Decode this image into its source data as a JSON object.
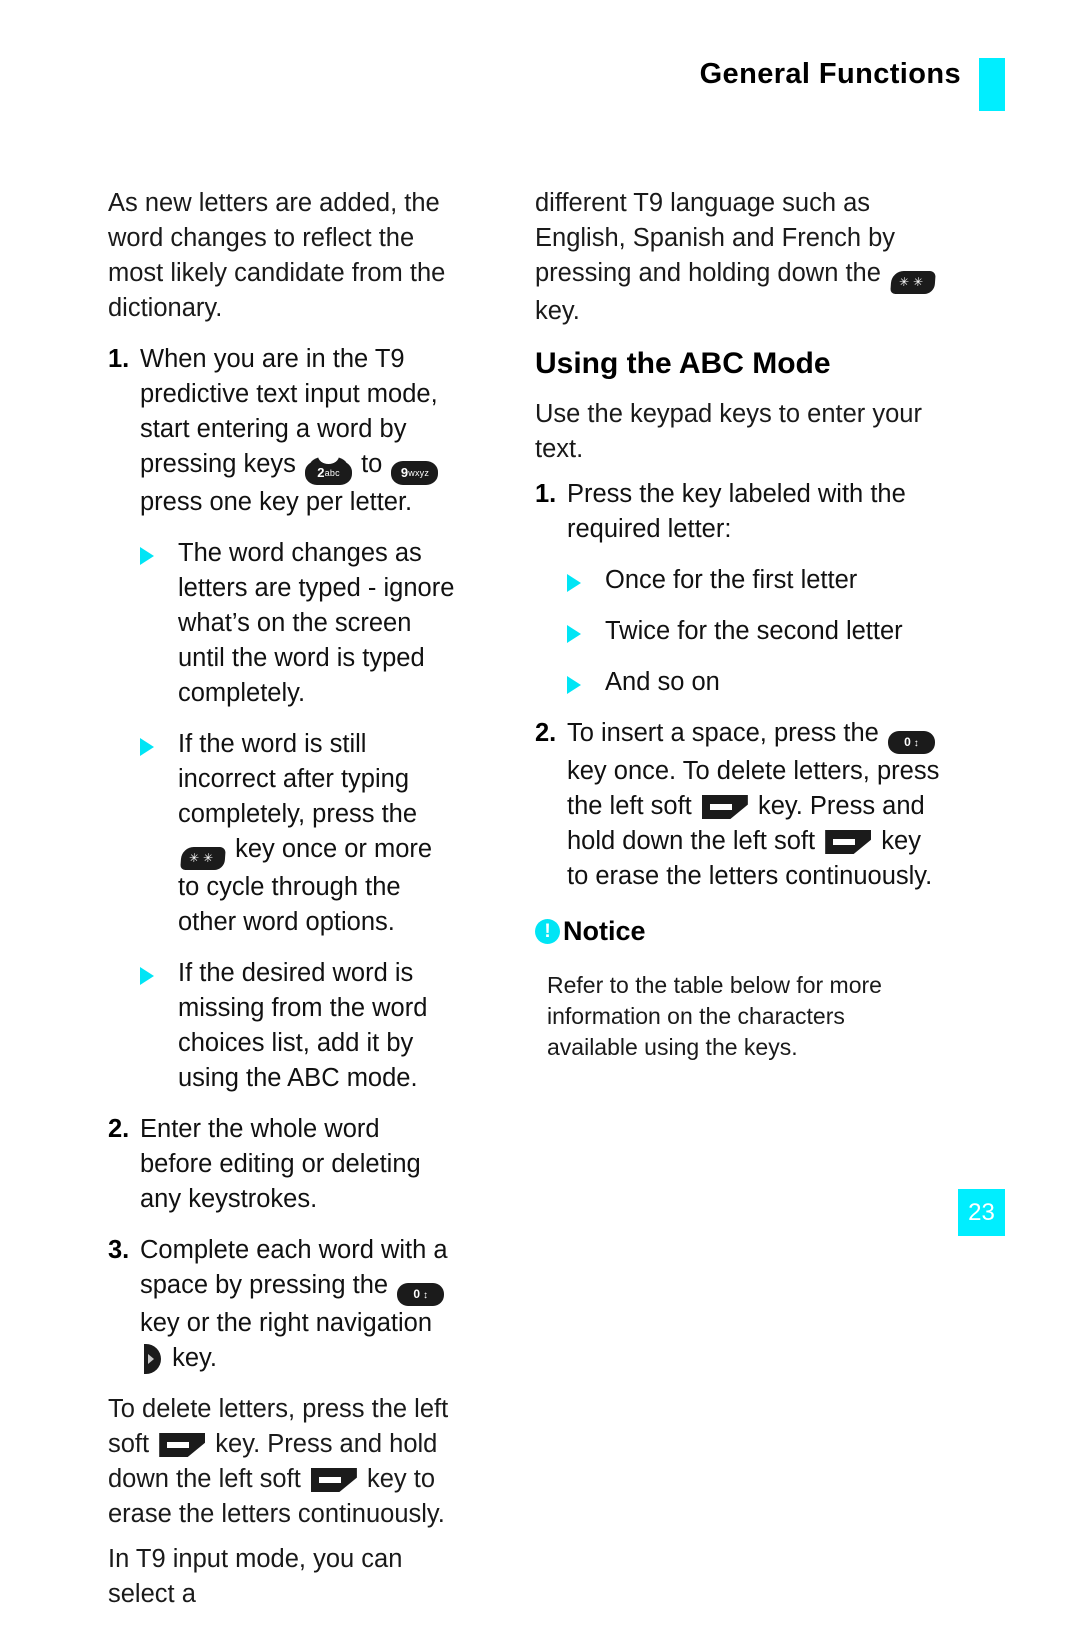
{
  "header": {
    "title": "General Functions",
    "accent_color": "#00eeff"
  },
  "page_number": "23",
  "colors": {
    "accent": "#00eeff",
    "bullet": "#00e5f5",
    "text": "#1a1a1a"
  },
  "left_column": {
    "intro": "As new letters are added, the word changes to reflect the most likely candidate from the dictionary.",
    "step1": {
      "num": "1.",
      "text_a": "When you are in the T9 predictive text input mode, start entering a word by pressing keys",
      "text_b": "to",
      "text_c": "press one key per letter.",
      "key_from": {
        "icon": "key-2-abc",
        "digit": "2",
        "letters": "abc"
      },
      "key_to": {
        "icon": "key-9-wxyz",
        "digit": "9",
        "letters": "wxyz"
      }
    },
    "bullets": [
      {
        "text": "The word changes as letters are typed - ignore what’s on the screen until the word is typed completely."
      },
      {
        "text_a": "If the word is still incorrect after typing completely, press the",
        "key": {
          "icon": "key-star",
          "label": "✱✱"
        },
        "text_b": "key once or more to cycle through the other word options."
      },
      {
        "text": "If the desired word is missing from the word choices list, add it by using the ABC mode."
      }
    ],
    "step2": {
      "num": "2.",
      "text": "Enter the whole word before editing or deleting any keystrokes."
    },
    "step3": {
      "num": "3.",
      "text_a": "Complete each word with a space by pressing the",
      "key_zero": {
        "icon": "key-0",
        "digit": "0",
        "symbol": "↕"
      },
      "text_b": "key or the right navigation",
      "key_nav": {
        "icon": "key-nav-right"
      },
      "text_c": "key."
    },
    "delete_para": {
      "text_a": "To delete letters, press the left soft",
      "key_soft_1": {
        "icon": "key-soft-left"
      },
      "text_b": "key. Press and hold down the left soft",
      "key_soft_2": {
        "icon": "key-soft-left"
      },
      "text_c": "key to erase the letters continuously."
    },
    "tail": "In T9 input mode, you can select a"
  },
  "right_column": {
    "continuation": {
      "text_a": "different T9 language such as English, Spanish and French by pressing and holding down the",
      "key": {
        "icon": "key-star",
        "label": "✱✱"
      },
      "text_b": "key."
    },
    "heading": "Using the ABC Mode",
    "lead": "Use the keypad keys to enter your text.",
    "step1": {
      "num": "1.",
      "text": "Press the key labeled with the required letter:"
    },
    "bullets": [
      "Once for the first letter",
      "Twice for the second letter",
      "And so on"
    ],
    "step2": {
      "num": "2.",
      "text_a": "To insert a space, press the",
      "key_zero": {
        "icon": "key-0",
        "digit": "0",
        "symbol": "↕"
      },
      "text_b": "key once. To delete letters, press the left soft",
      "key_soft_1": {
        "icon": "key-soft-left"
      },
      "text_c": "key. Press and hold down the left soft",
      "key_soft_2": {
        "icon": "key-soft-left"
      },
      "text_d": "key to erase the letters continuously."
    },
    "notice": {
      "icon_label": "!",
      "title": "Notice",
      "body": "Refer to the table below for more information on the characters available using the keys."
    }
  }
}
